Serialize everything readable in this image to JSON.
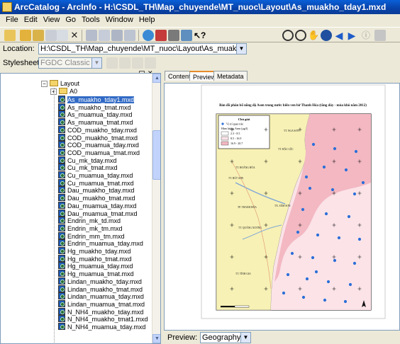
{
  "window": {
    "title": "ArcCatalog - ArcInfo - H:\\CSDL_TH\\Map_chuyende\\MT_nuoc\\Layout\\As_muakho_tday1.mxd"
  },
  "menu": [
    "File",
    "Edit",
    "View",
    "Go",
    "Tools",
    "Window",
    "Help"
  ],
  "location": {
    "label": "Location:",
    "value": "H:\\CSDL_TH\\Map_chuyende\\MT_nuoc\\Layout\\As_muakho_tday1.mxd"
  },
  "stylesheet": {
    "label": "Stylesheet:",
    "value": "FGDC Classic"
  },
  "tree": {
    "layout_folder": "Layout",
    "a0_folder": "A0",
    "files": [
      "As_muakho_tday1.mxd",
      "As_muakho_tmat.mxd",
      "As_muamua_tday.mxd",
      "As_muamua_tmat.mxd",
      "COD_muakho_tday.mxd",
      "COD_muakho_tmat.mxd",
      "COD_muamua_tday.mxd",
      "COD_muamua_tmat.mxd",
      "Cu_mk_tday.mxd",
      "Cu_mk_tmat.mxd",
      "Cu_muamua_tday.mxd",
      "Cu_muamua_tmat.mxd",
      "Dau_muakho_tday.mxd",
      "Dau_muakho_tmat.mxd",
      "Dau_muamua_tday.mxd",
      "Dau_muamua_tmat.mxd",
      "Endrin_mk_td.mxd",
      "Endrin_mk_tm.mxd",
      "Endrin_mm_tm.mxd",
      "Endrin_muamua_tday.mxd",
      "Hg_muakho_tday.mxd",
      "Hg_muakho_tmat.mxd",
      "Hg_muamua_tday.mxd",
      "Hg_muamua_tmat.mxd",
      "Lindan_muakho_tday.mxd",
      "Lindan_muakho_tmat.mxd",
      "Lindan_muamua_tday.mxd",
      "Lindan_muamua_tmat.mxd",
      "N_NH4_muakho_tday.mxd",
      "N_NH4_muakho_tmat1.mxd",
      "N_NH4_muamua_tday.mxd"
    ]
  },
  "tabs": [
    "Contents",
    "Preview",
    "Metadata"
  ],
  "preview": {
    "label": "Preview:",
    "mode": "Geography"
  },
  "map": {
    "title": "Bản đồ phân bố nồng độ Asen trong nước biển ven bờ Thanh Hóa (tầng đáy - mùa khô năm 2012)",
    "legend_title": "Chú giải",
    "legend_point": "Vị trí quan trắc",
    "legend_conc_title": "Hàm lượng Asen (µg/l)",
    "classes": [
      "2.3 - 8.5",
      "8.5 - 16.9",
      "16.9 - 20.7"
    ],
    "towns": [
      "TT. HOẰNG HÓA",
      "TT. BÚT SƠN",
      "TX. SẦM SƠN",
      "TP. THANH HÓA",
      "TT. QUẢNG XƯƠNG",
      "TT. TĨNH GIA",
      "TT. HẬU LỘC",
      "TT. NGA SƠN"
    ],
    "colors": {
      "land": "#f7f1b5",
      "low": "#fbe3e8",
      "mid": "#f3b8c2",
      "sea": "#d9ecf7",
      "point": "#2b6fd8"
    }
  }
}
